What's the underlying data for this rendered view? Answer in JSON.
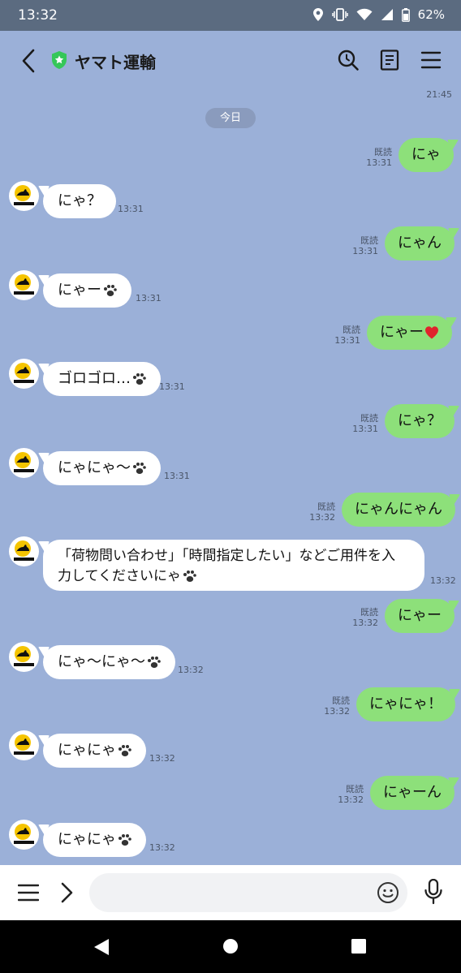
{
  "status_bar": {
    "time": "13:32",
    "battery": "62%"
  },
  "header": {
    "title": "ヤマト運輸"
  },
  "chat": {
    "top_time": "21:45",
    "date_separator": "今日",
    "read_label": "既読",
    "messages": [
      {
        "text": "にゃ",
        "time": "13:31"
      },
      {
        "text": "にゃ？",
        "time": "13:31"
      },
      {
        "text": "にゃん",
        "time": "13:31"
      },
      {
        "text": "にゃー",
        "time": "13:31"
      },
      {
        "text": "にゃー",
        "time": "13:31"
      },
      {
        "text": "ゴロゴロ…",
        "time": "13:31"
      },
      {
        "text": "にゃ？",
        "time": "13:31"
      },
      {
        "text": "にゃにゃ〜",
        "time": "13:31"
      },
      {
        "text": "にゃんにゃん",
        "time": "13:32"
      },
      {
        "line1": "「荷物問い合わせ」「時間指定したい」などご用件を入",
        "line2": "力してくださいにゃ",
        "time": "13:32"
      },
      {
        "text": "にゃー",
        "time": "13:32"
      },
      {
        "text": "にゃ〜にゃ〜",
        "time": "13:32"
      },
      {
        "text": "にゃにゃ！",
        "time": "13:32"
      },
      {
        "text": "にゃにゃ",
        "time": "13:32"
      },
      {
        "text": "にゃーん",
        "time": "13:32"
      },
      {
        "text": "にゃにゃ",
        "time": "13:32"
      }
    ]
  },
  "input": {
    "placeholder": ""
  },
  "colors": {
    "sent_bubble": "#8de07a",
    "received_bubble": "#ffffff",
    "chat_background": "#9bb0d8",
    "heart": "#e0242c",
    "shield": "#35c759"
  }
}
